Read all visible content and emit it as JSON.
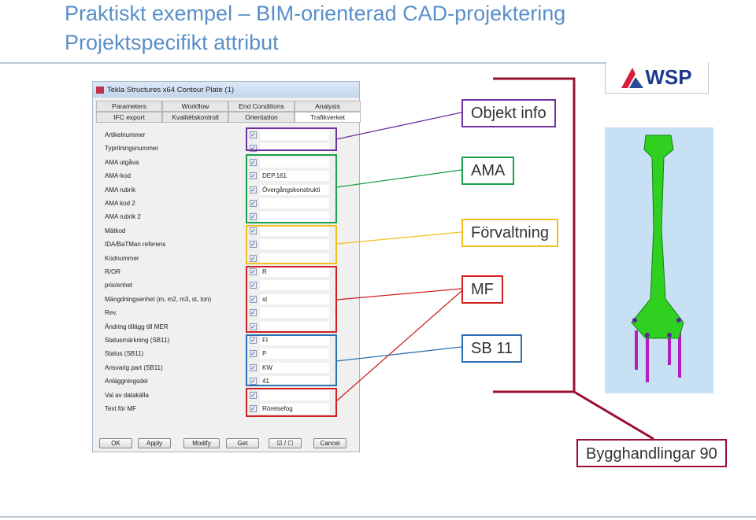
{
  "slide": {
    "title_line1": "Praktiskt exempel – BIM-orienterad CAD-projektering",
    "title_line2": "Projektspecifikt attribut"
  },
  "logo": {
    "text": "WSP",
    "color": "#d81e3a"
  },
  "dialog": {
    "title": "Tekla Structures x64  Contour Plate (1)",
    "tabs_row1": [
      "Parameters",
      "Workflow",
      "End Conditions",
      "Analysis"
    ],
    "tabs_row2": [
      "IFC export",
      "Kvalitétskontroll",
      "Orientation",
      "Trafikverket"
    ],
    "active_tab": "Trafikverket",
    "fields": [
      {
        "label": "Artikelnummer",
        "checked": true,
        "value": ""
      },
      {
        "label": "Typritningsnummer",
        "checked": true,
        "value": ""
      },
      {
        "label": "AMA utgåva",
        "checked": true,
        "value": ""
      },
      {
        "label": "AMA-kod",
        "checked": true,
        "value": "DEP.161"
      },
      {
        "label": "AMA rubrik",
        "checked": true,
        "value": "Övergångskonstrukti"
      },
      {
        "label": "AMA kod 2",
        "checked": true,
        "value": ""
      },
      {
        "label": "AMA rubrik 2",
        "checked": true,
        "value": ""
      },
      {
        "label": "Mätkod",
        "checked": true,
        "value": ""
      },
      {
        "label": "IDA/BaTMan referens",
        "checked": true,
        "value": ""
      },
      {
        "label": "Kodnummer",
        "checked": true,
        "value": ""
      },
      {
        "label": "R/OR",
        "checked": true,
        "value": "R"
      },
      {
        "label": "pris/enhet",
        "checked": true,
        "value": ""
      },
      {
        "label": "Mängdningsenhet (m, m2, m3, st, ton)",
        "checked": true,
        "value": "st"
      },
      {
        "label": "Rev.",
        "checked": true,
        "value": ""
      },
      {
        "label": "Ändring  tillägg till MER",
        "checked": true,
        "value": ""
      },
      {
        "label": "Statusmärkning (SB11)",
        "checked": true,
        "value": "FI"
      },
      {
        "label": "Status (SB11)",
        "checked": true,
        "value": "P"
      },
      {
        "label": "Ansvarig part (SB11)",
        "checked": true,
        "value": "KW"
      },
      {
        "label": "Anläggningsdel",
        "checked": true,
        "value": "41"
      },
      {
        "label": "Val av datakälla",
        "checked": true,
        "value": ""
      },
      {
        "label": "Text för MF",
        "checked": true,
        "value": "Rörelsefog"
      }
    ],
    "buttons": [
      "OK",
      "Apply",
      "Modify",
      "Get",
      "☑ / ☐",
      "Cancel"
    ]
  },
  "callouts": [
    {
      "label": "Objekt info",
      "color": "#7030a0"
    },
    {
      "label": "AMA",
      "color": "#1aa04a"
    },
    {
      "label": "Förvaltning",
      "color": "#f0c020"
    },
    {
      "label": "MF",
      "color": "#d02020"
    },
    {
      "label": "SB 11",
      "color": "#2a70b0"
    }
  ],
  "bracket": {
    "label": "Bygghandlingar 90",
    "color": "#9a1030"
  }
}
